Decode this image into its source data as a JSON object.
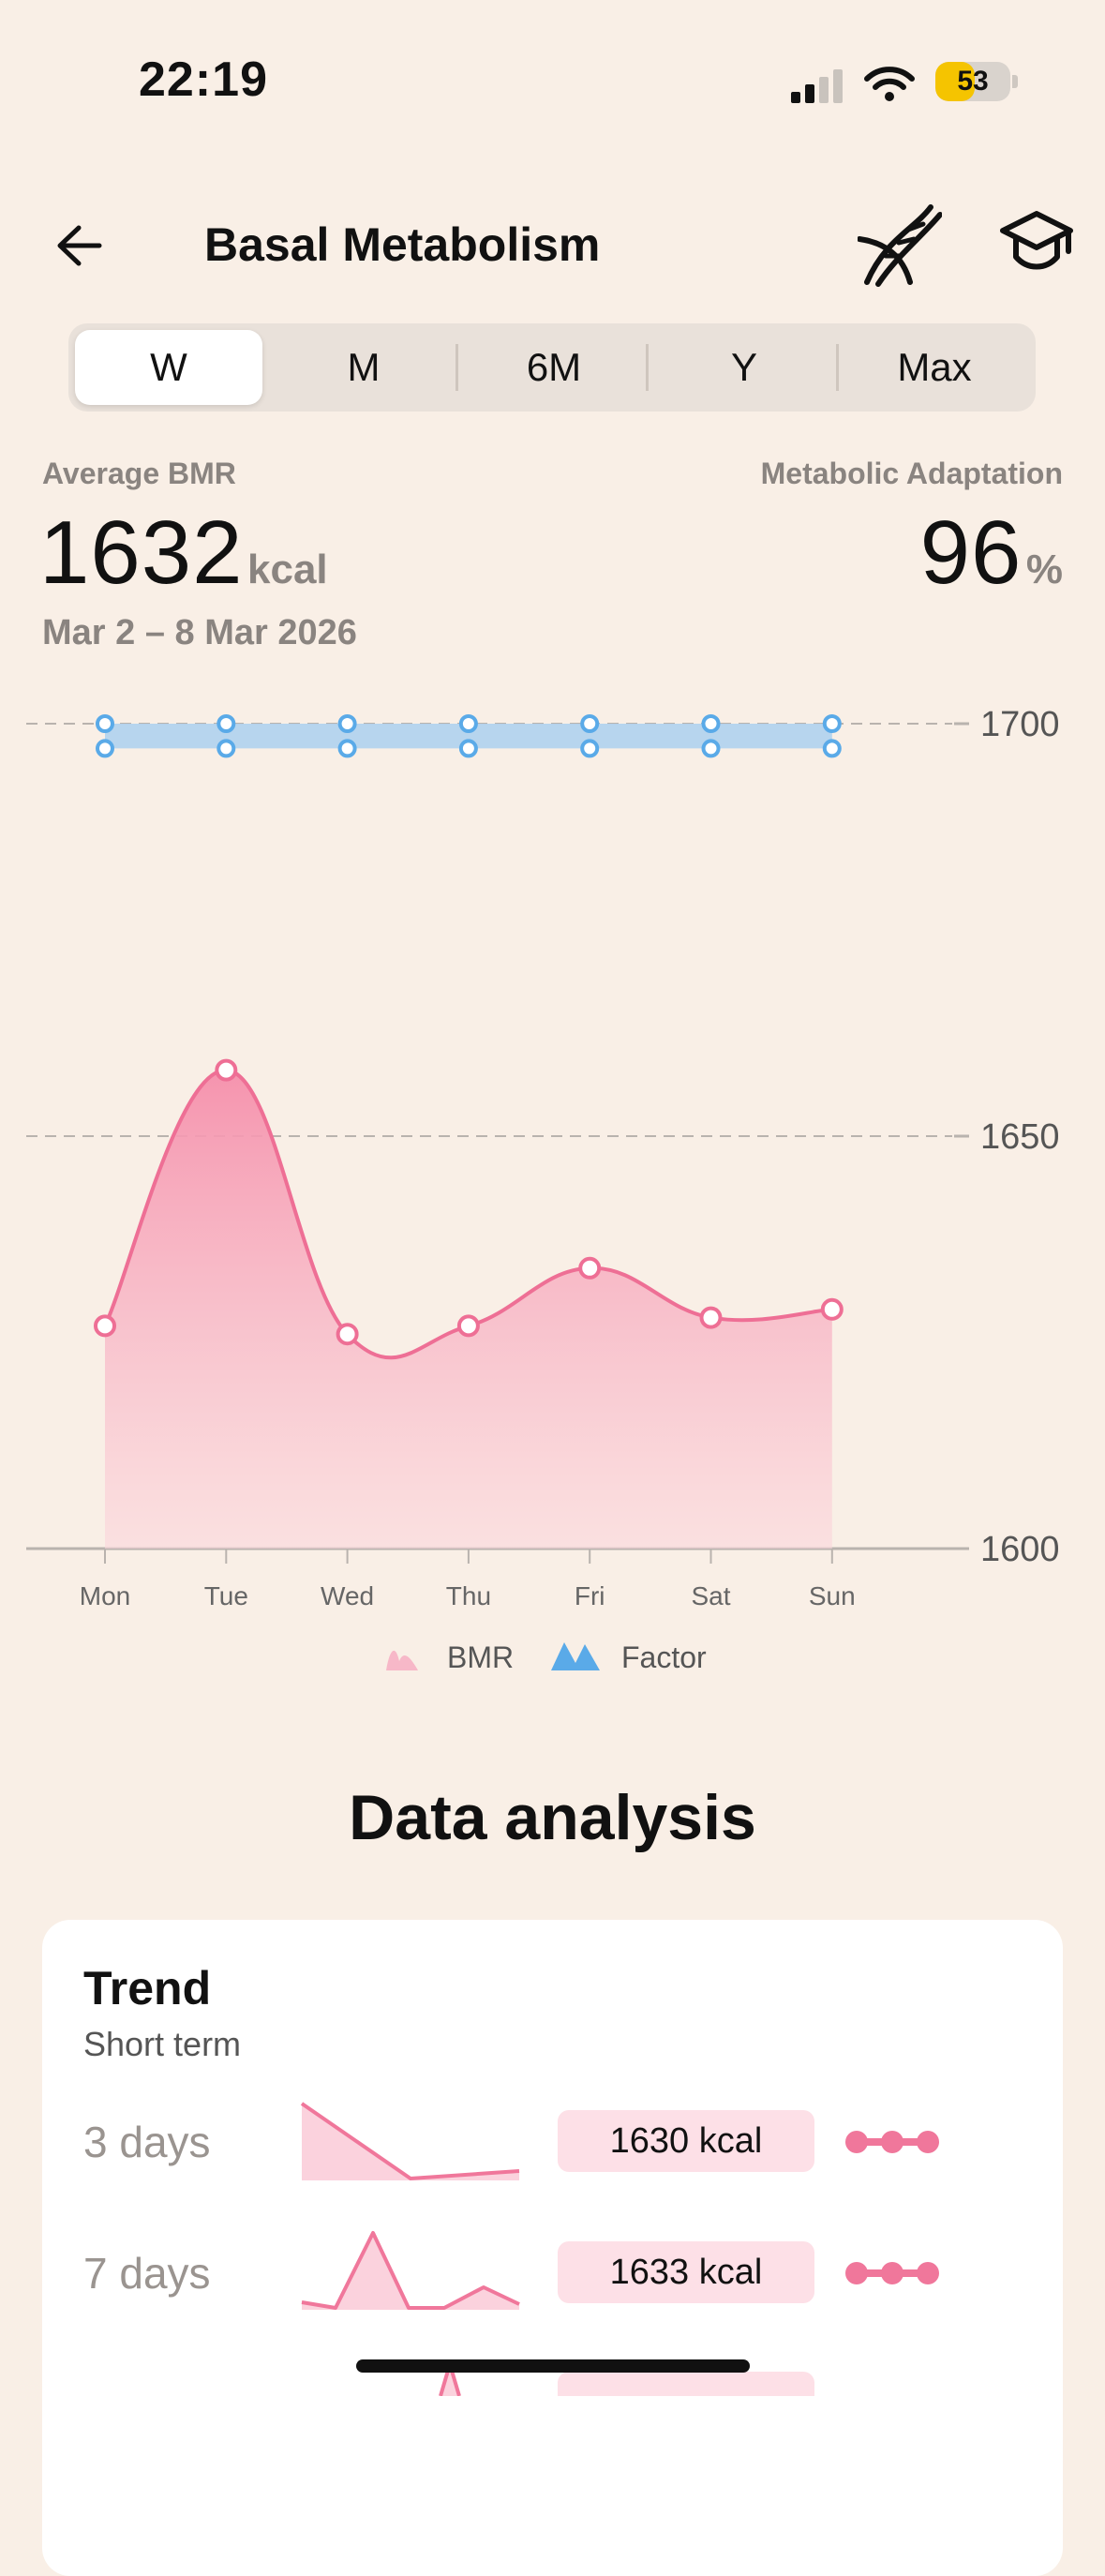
{
  "status_bar": {
    "time": "22:19",
    "battery": "53"
  },
  "header": {
    "title": "Basal Metabolism",
    "back_icon": "arrow-left-icon",
    "dna_icon": "dna-icon",
    "learn_icon": "graduation-cap-icon"
  },
  "periods": [
    "W",
    "M",
    "6M",
    "Y",
    "Max"
  ],
  "selected_period": "W",
  "stats": {
    "avg_label": "Average BMR",
    "avg_value": "1632",
    "avg_unit": "kcal",
    "adapt_label": "Metabolic Adaptation",
    "adapt_value": "96",
    "adapt_unit": "%",
    "date_range": "Mar 2 – 8 Mar 2026"
  },
  "chart_data": {
    "type": "area",
    "categories": [
      "Mon",
      "Tue",
      "Wed",
      "Thu",
      "Fri",
      "Sat",
      "Sun"
    ],
    "ylim": [
      1600,
      1700
    ],
    "yticks": [
      "1700",
      "1650",
      "1600"
    ],
    "series": [
      {
        "name": "BMR",
        "values": [
          1627,
          1658,
          1626,
          1627,
          1634,
          1628,
          1629
        ],
        "color": "#f0779b"
      },
      {
        "name": "Factor",
        "upper": [
          1700,
          1700,
          1700,
          1700,
          1700,
          1700,
          1700
        ],
        "lower": [
          1697,
          1697,
          1697,
          1697,
          1697,
          1697,
          1697
        ],
        "color": "#5aaae8"
      }
    ],
    "legend": [
      "BMR",
      "Factor"
    ],
    "grid": "dashed at 1700 and 1650"
  },
  "analysis": {
    "title": "Data analysis",
    "trend_title": "Trend",
    "trend_sub": "Short term",
    "rows": [
      {
        "label": "3 days",
        "value": "1630  kcal"
      },
      {
        "label": "7 days",
        "value": "1633  kcal"
      }
    ]
  }
}
